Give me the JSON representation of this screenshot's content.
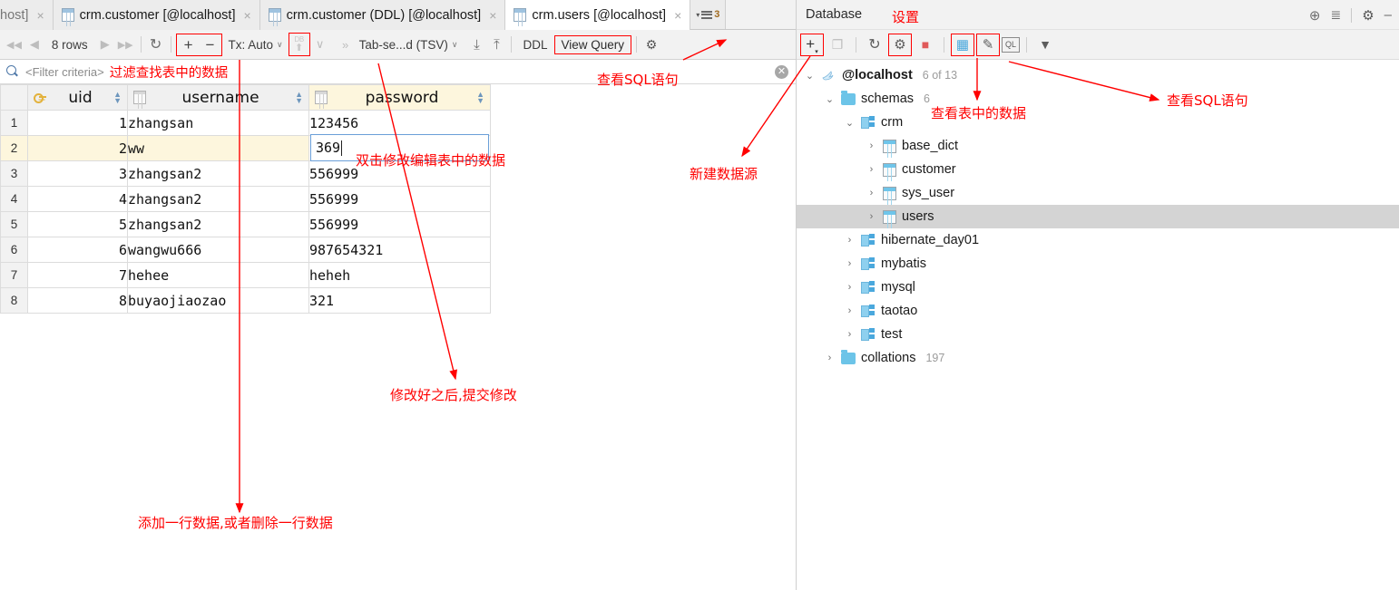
{
  "tabs": {
    "items": [
      {
        "label": "host]",
        "icon": "table-icon",
        "active": false,
        "truncated": true
      },
      {
        "label": "crm.customer [@localhost]",
        "icon": "table-icon",
        "active": false,
        "truncated": false
      },
      {
        "label": "crm.customer (DDL) [@localhost]",
        "icon": "table-icon",
        "active": false,
        "truncated": false
      },
      {
        "label": "crm.users [@localhost]",
        "icon": "table-icon",
        "active": true,
        "truncated": false
      }
    ],
    "close_glyph": "×",
    "overflow": {
      "caret": "▾",
      "icon": "tab-list-icon",
      "count": "3"
    }
  },
  "grid_toolbar": {
    "first_page": "⏮",
    "prev_page": "◀",
    "row_count": "8 rows",
    "next_page": "▶",
    "last_page": "⏭",
    "reload": "↻",
    "add_row": "+",
    "remove_row": "−",
    "tx_mode": "Tx: Auto",
    "tx_caret": "∨",
    "submit_db_label": "DB",
    "submit_db_arrow": "⬆",
    "submit_caret": "∨",
    "more_chevrons": "»",
    "format": "Tab-se...d (TSV)",
    "format_caret": "∨",
    "import_icon": "download-icon",
    "export_icon": "upload-icon",
    "ddl": "DDL",
    "view_query": "View Query",
    "settings_icon": "gear-icon"
  },
  "filter": {
    "icon": "search-icon",
    "placeholder": "<Filter criteria>",
    "annotation": "过滤查找表中的数据",
    "clear": "✕"
  },
  "table": {
    "columns": [
      {
        "name": "uid",
        "icon": "primary-key-icon",
        "highlight": false
      },
      {
        "name": "username",
        "icon": "column-icon",
        "highlight": false
      },
      {
        "name": "password",
        "icon": "column-icon",
        "highlight": true
      }
    ],
    "rows": [
      {
        "n": "1",
        "uid": "1",
        "username": "zhangsan",
        "password": "123456"
      },
      {
        "n": "2",
        "uid": "2",
        "username": "ww",
        "password": "369",
        "editing": true
      },
      {
        "n": "3",
        "uid": "3",
        "username": "zhangsan2",
        "password": "556999"
      },
      {
        "n": "4",
        "uid": "4",
        "username": "zhangsan2",
        "password": "556999"
      },
      {
        "n": "5",
        "uid": "5",
        "username": "zhangsan2",
        "password": "556999"
      },
      {
        "n": "6",
        "uid": "6",
        "username": "wangwu666",
        "password": "987654321"
      },
      {
        "n": "7",
        "uid": "7",
        "username": "hehee",
        "password": "heheh"
      },
      {
        "n": "8",
        "uid": "8",
        "username": "buyaojiaozao",
        "password": "321"
      }
    ]
  },
  "db_panel": {
    "title": "Database",
    "header_icons": [
      "locate-icon",
      "collapse-all-icon",
      "gear-icon",
      "minimize-icon"
    ],
    "toolbar": [
      {
        "name": "add-datasource-icon",
        "glyph": "+"
      },
      {
        "name": "copy-icon",
        "glyph": "❐"
      },
      {
        "name": "refresh-icon",
        "glyph": "↻"
      },
      {
        "name": "settings-wrench-icon",
        "glyph": "⚒"
      },
      {
        "name": "stop-icon",
        "glyph": "■"
      },
      {
        "name": "view-data-icon",
        "glyph": "▦"
      },
      {
        "name": "edit-icon",
        "glyph": "✎"
      },
      {
        "name": "sql-console-icon",
        "glyph": "QL"
      },
      {
        "name": "filter-icon",
        "glyph": "▼"
      }
    ],
    "tree": [
      {
        "id": "localhost",
        "label": "@localhost",
        "count": "6 of 13",
        "depth": 0,
        "twist": "⌄",
        "icon": "mysql-icon",
        "bold": true,
        "selected": false
      },
      {
        "id": "schemas",
        "label": "schemas",
        "count": "6",
        "depth": 1,
        "twist": "⌄",
        "icon": "folder-icon",
        "bold": false,
        "selected": false
      },
      {
        "id": "crm",
        "label": "crm",
        "count": "",
        "depth": 2,
        "twist": "⌄",
        "icon": "schema-icon",
        "bold": false,
        "selected": false
      },
      {
        "id": "base_dict",
        "label": "base_dict",
        "count": "",
        "depth": 3,
        "twist": "›",
        "icon": "table-icon",
        "bold": false,
        "selected": false
      },
      {
        "id": "customer",
        "label": "customer",
        "count": "",
        "depth": 3,
        "twist": "›",
        "icon": "table-icon",
        "bold": false,
        "selected": false
      },
      {
        "id": "sys_user",
        "label": "sys_user",
        "count": "",
        "depth": 3,
        "twist": "›",
        "icon": "table-icon",
        "bold": false,
        "selected": false
      },
      {
        "id": "users",
        "label": "users",
        "count": "",
        "depth": 3,
        "twist": "›",
        "icon": "table-icon",
        "bold": false,
        "selected": true
      },
      {
        "id": "hibernate_day01",
        "label": "hibernate_day01",
        "count": "",
        "depth": 2,
        "twist": "›",
        "icon": "schema-icon",
        "bold": false,
        "selected": false
      },
      {
        "id": "mybatis",
        "label": "mybatis",
        "count": "",
        "depth": 2,
        "twist": "›",
        "icon": "schema-icon",
        "bold": false,
        "selected": false
      },
      {
        "id": "mysql",
        "label": "mysql",
        "count": "",
        "depth": 2,
        "twist": "›",
        "icon": "schema-icon",
        "bold": false,
        "selected": false
      },
      {
        "id": "taotao",
        "label": "taotao",
        "count": "",
        "depth": 2,
        "twist": "›",
        "icon": "schema-icon",
        "bold": false,
        "selected": false
      },
      {
        "id": "test",
        "label": "test",
        "count": "",
        "depth": 2,
        "twist": "›",
        "icon": "schema-icon",
        "bold": false,
        "selected": false
      },
      {
        "id": "collations",
        "label": "collations",
        "count": "197",
        "depth": 1,
        "twist": "›",
        "icon": "folder-icon",
        "bold": false,
        "selected": false
      }
    ]
  },
  "annotations": {
    "filter_data": "过滤查找表中的数据",
    "view_sql_left": "查看SQL语句",
    "edit_cell": "双击修改编辑表中的数据",
    "new_datasource": "新建数据源",
    "submit_changes": "修改好之后,提交修改",
    "add_delete_row": "添加一行数据,或者删除一行数据",
    "settings": "设置",
    "view_table_data": "查看表中的数据",
    "view_sql_right": "查看SQL语句"
  },
  "colors": {
    "annotation_red": "#ff0000",
    "selection_gray": "#d4d4d4",
    "highlight_cream": "#fdf6dd"
  }
}
